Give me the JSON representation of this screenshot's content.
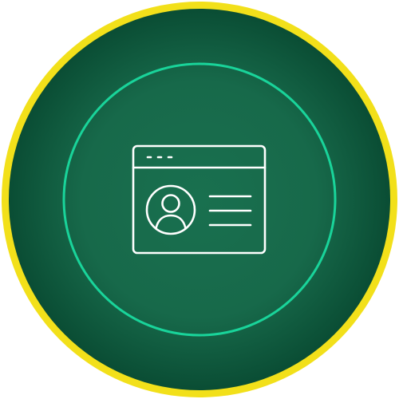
{
  "badge": {
    "outer_ring_color": "#f2e01a",
    "disc_edge_color": "#0a4d34",
    "disc_center_color": "#19704f",
    "inner_ring_color": "#19d49a",
    "icon_color": "#ffffff",
    "icon": "browser-window-profile-icon"
  }
}
